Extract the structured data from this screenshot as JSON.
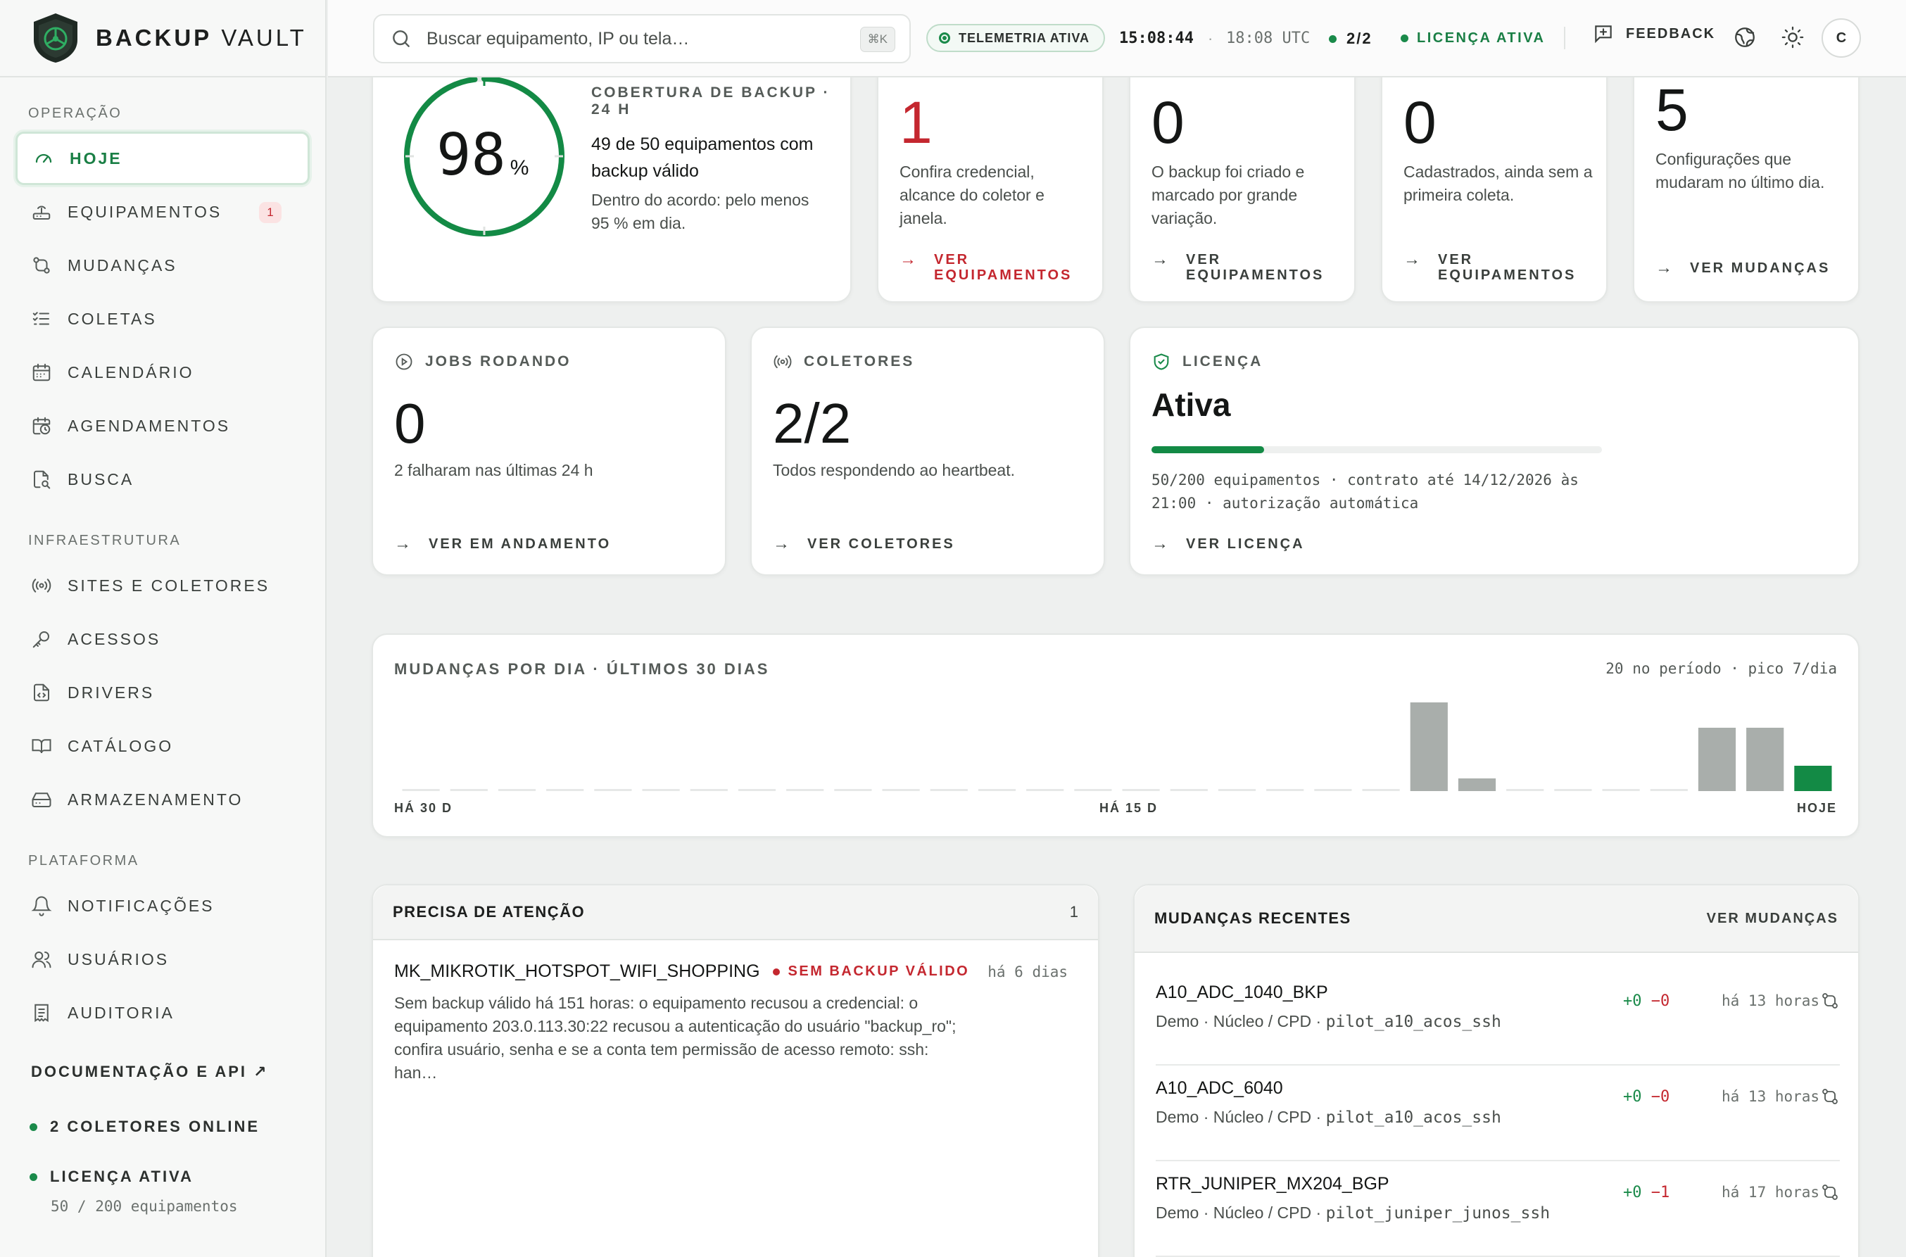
{
  "brand": {
    "name_bold": "BACKUP",
    "name_light": "VAULT"
  },
  "sidebar": {
    "sections": [
      {
        "title": "OPERAÇÃO",
        "items": [
          {
            "label": "HOJE",
            "icon": "gauge-icon",
            "active": true
          },
          {
            "label": "EQUIPAMENTOS",
            "icon": "router-icon",
            "badge": "1"
          },
          {
            "label": "MUDANÇAS",
            "icon": "git-compare-icon"
          },
          {
            "label": "COLETAS",
            "icon": "list-check-icon"
          },
          {
            "label": "CALENDÁRIO",
            "icon": "calendar-icon"
          },
          {
            "label": "AGENDAMENTOS",
            "icon": "calendar-clock-icon"
          },
          {
            "label": "BUSCA",
            "icon": "file-search-icon"
          }
        ]
      },
      {
        "title": "INFRAESTRUTURA",
        "items": [
          {
            "label": "SITES E COLETORES",
            "icon": "radio-icon"
          },
          {
            "label": "ACESSOS",
            "icon": "key-icon"
          },
          {
            "label": "DRIVERS",
            "icon": "file-code-icon"
          },
          {
            "label": "CATÁLOGO",
            "icon": "book-open-icon"
          },
          {
            "label": "ARMAZENAMENTO",
            "icon": "hard-drive-icon"
          }
        ]
      },
      {
        "title": "PLATAFORMA",
        "items": [
          {
            "label": "NOTIFICAÇÕES",
            "icon": "bell-icon"
          },
          {
            "label": "USUÁRIOS",
            "icon": "users-icon"
          },
          {
            "label": "AUDITORIA",
            "icon": "receipt-icon"
          }
        ]
      }
    ],
    "docs_link": "DOCUMENTAÇÃO E API ↗",
    "collectors_status": "2 COLETORES ONLINE",
    "license_status": "LICENÇA ATIVA",
    "license_sub": "50 / 200 equipamentos"
  },
  "topbar": {
    "search_placeholder": "Buscar equipamento, IP ou tela…",
    "search_shortcut": "⌘K",
    "telemetry": "TELEMETRIA ATIVA",
    "local_time": "15:08:44",
    "utc_time": "18:08 UTC",
    "collectors": "2/2",
    "license": "LICENÇA ATIVA",
    "feedback": "FEEDBACK",
    "avatar_initial": "C"
  },
  "coverage": {
    "percent": "98",
    "percent_sign": "%",
    "percent_value": 98,
    "label": "COBERTURA DE BACKUP · 24 H",
    "headline": "49 de 50 equipamentos com backup válido",
    "note": "Dentro do acordo: pelo menos 95 % em dia."
  },
  "stat_cards": [
    {
      "number": "1",
      "desc": "Confira credencial, alcance do coletor e janela.",
      "link": "VER EQUIPAMENTOS",
      "alert": true
    },
    {
      "number": "0",
      "desc": "O backup foi criado e marcado por grande variação.",
      "link": "VER EQUIPAMENTOS"
    },
    {
      "number": "0",
      "desc": "Cadastrados, ainda sem a primeira coleta.",
      "link": "VER EQUIPAMENTOS"
    },
    {
      "number": "5",
      "desc": "Configurações que mudaram no último dia.",
      "link": "VER MUDANÇAS"
    }
  ],
  "jobs": {
    "label": "JOBS RODANDO",
    "number": "0",
    "desc": "2 falharam nas últimas 24 h",
    "link": "VER EM ANDAMENTO"
  },
  "collectors": {
    "label": "COLETORES",
    "number": "2/2",
    "desc": "Todos respondendo ao heartbeat.",
    "link": "VER COLETORES"
  },
  "license": {
    "label": "LICENÇA",
    "status": "Ativa",
    "usage_fraction": 0.25,
    "detail_1": "50/200 equipamentos · contrato até 14/12/2026 às",
    "detail_2": "21:00 · autorização automática",
    "link": "VER LICENÇA"
  },
  "chart": {
    "title": "MUDANÇAS POR DIA · ÚLTIMOS 30 DIAS",
    "meta": "20 no período · pico 7/dia",
    "axis_start": "HÁ 30 D",
    "axis_mid": "HÁ 15 D",
    "axis_end": "HOJE"
  },
  "chart_data": {
    "type": "bar",
    "title": "MUDANÇAS POR DIA · ÚLTIMOS 30 DIAS",
    "categories": [
      "HÁ 30 D",
      "",
      "",
      "",
      "",
      "",
      "",
      "",
      "",
      "",
      "",
      "",
      "",
      "",
      "",
      "HÁ 15 D",
      "",
      "",
      "",
      "",
      "",
      "",
      "",
      "",
      "",
      "",
      "",
      "",
      "",
      "HOJE"
    ],
    "values": [
      0,
      0,
      0,
      0,
      0,
      0,
      0,
      0,
      0,
      0,
      0,
      0,
      0,
      0,
      0,
      0,
      0,
      0,
      0,
      0,
      0,
      7,
      1,
      0,
      0,
      0,
      0,
      5,
      5,
      2
    ],
    "ylim": [
      0,
      7
    ],
    "highlight_last": true,
    "colors": {
      "bar": "#a9aeab",
      "today": "#138a45",
      "empty": "#e6e8e7"
    }
  },
  "attention": {
    "title": "PRECISA DE ATENÇÃO",
    "count": "1",
    "items": [
      {
        "device": "MK_MIKROTIK_HOTSPOT_WIFI_SHOPPING",
        "status": "SEM BACKUP VÁLIDO",
        "age": "há 6 dias",
        "text": "Sem backup válido há 151 horas: o equipamento recusou a credencial: o equipamento 203.0.113.30:22 recusou a autenticação do usuário \"backup_ro\"; confira usuário, senha e se a conta tem permissão de acesso remoto: ssh: han…"
      }
    ]
  },
  "recent": {
    "title": "MUDANÇAS RECENTES",
    "link": "VER MUDANÇAS",
    "items": [
      {
        "device": "A10_ADC_1040_BKP",
        "site": "Demo · Núcleo / CPD · ",
        "driver": "pilot_a10_acos_ssh",
        "added": "+0",
        "removed": "−0",
        "age": "há 13 horas"
      },
      {
        "device": "A10_ADC_6040",
        "site": "Demo · Núcleo / CPD · ",
        "driver": "pilot_a10_acos_ssh",
        "added": "+0",
        "removed": "−0",
        "age": "há 13 horas"
      },
      {
        "device": "RTR_JUNIPER_MX204_BGP",
        "site": "Demo · Núcleo / CPD · ",
        "driver": "pilot_juniper_junos_ssh",
        "added": "+0",
        "removed": "−1",
        "age": "há 17 horas"
      }
    ]
  },
  "colors": {
    "accent": "#1a8a4a",
    "alert": "#c4272f"
  }
}
